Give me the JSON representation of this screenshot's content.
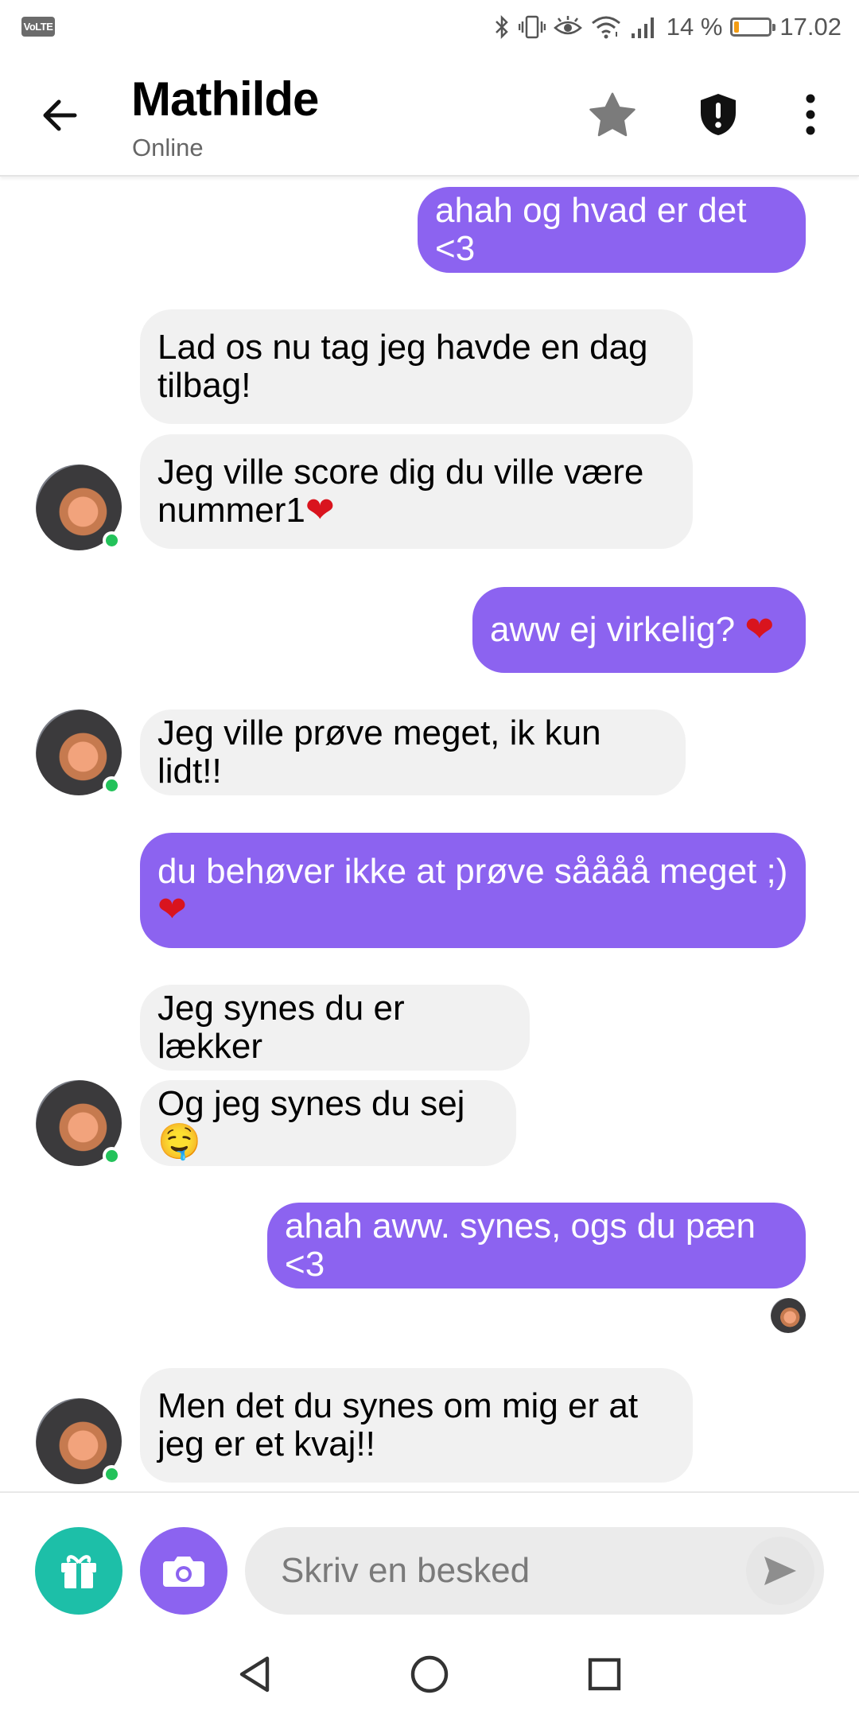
{
  "status_bar": {
    "volte": "VoLTE",
    "battery_percent": "14 %",
    "battery_level": 0.14,
    "time": "17.02",
    "icons": [
      "bluetooth-icon",
      "vibrate-icon",
      "eye-icon",
      "wifi-icon",
      "signal-icon",
      "battery-icon"
    ]
  },
  "header": {
    "title": "Mathilde",
    "status": "Online",
    "icons": [
      "back-arrow-icon",
      "star-icon",
      "shield-alert-icon",
      "more-vert-icon"
    ]
  },
  "messages": [
    {
      "from": "me",
      "text": "ahah og hvad er det <3"
    },
    {
      "from": "them",
      "text": "Lad os nu tag jeg havde en dag tilbag!"
    },
    {
      "from": "them",
      "text": "Jeg ville score dig du ville være nummer1",
      "emoji": "❤"
    },
    {
      "from": "me",
      "text": "aww ej virkelig? ",
      "emoji": "❤"
    },
    {
      "from": "them",
      "text": "Jeg ville prøve meget, ik kun lidt!!"
    },
    {
      "from": "me",
      "text": "du behøver ikke at prøve såååå meget ;)",
      "emoji": "❤"
    },
    {
      "from": "them",
      "text": "Jeg synes du er lækker"
    },
    {
      "from": "them",
      "text": "Og jeg synes du sej",
      "emoji": "🤤"
    },
    {
      "from": "me",
      "text": "ahah aww. synes, ogs du pæn <3"
    },
    {
      "from": "them",
      "text": "Men det du synes om mig er at jeg er et kvaj!!"
    }
  ],
  "input": {
    "placeholder": "Skriv en besked",
    "icons": [
      "gift-icon",
      "camera-icon",
      "send-icon"
    ]
  },
  "nav_bar": {
    "icons": [
      "back-triangle-icon",
      "home-circle-icon",
      "recents-square-icon"
    ]
  },
  "colors": {
    "my_bubble": "#8c63f0",
    "their_bubble": "#f1f1f1",
    "gift_button": "#1dbfa8",
    "camera_button": "#8c63f0",
    "online_dot": "#23c25a"
  }
}
